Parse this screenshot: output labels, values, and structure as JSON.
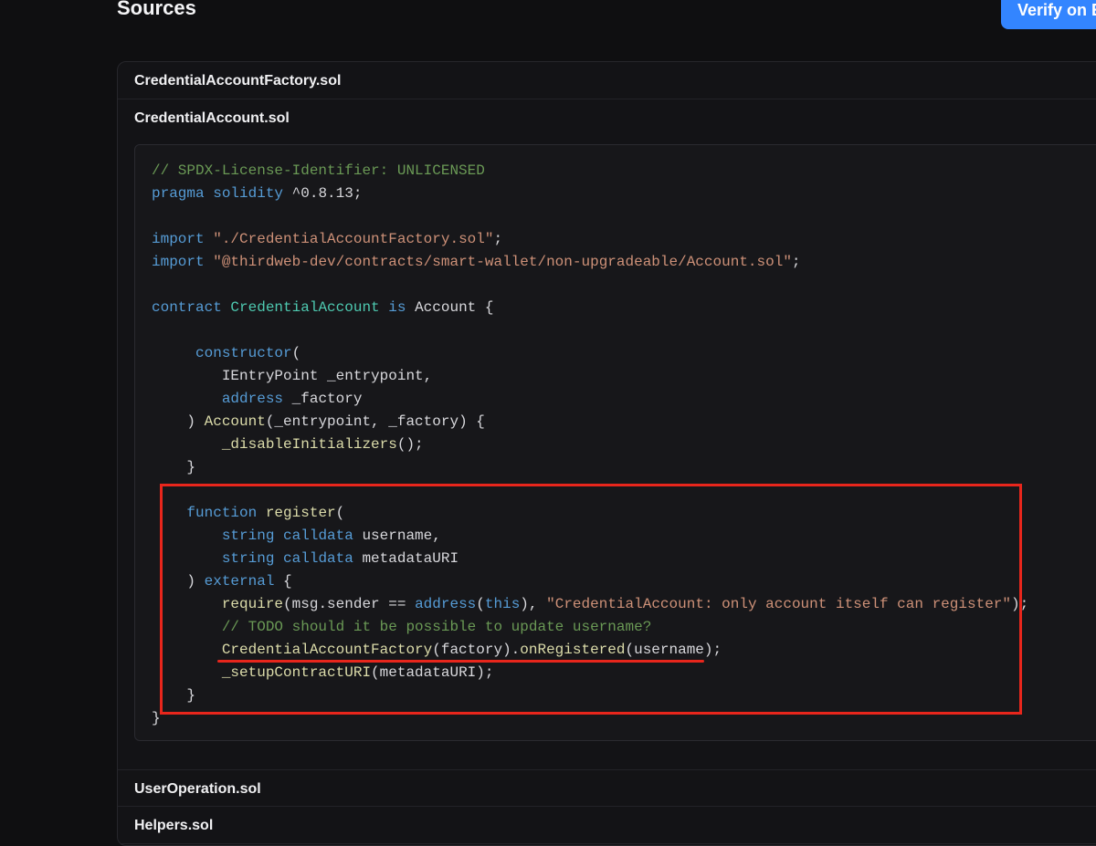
{
  "header": {
    "title": "Sources",
    "verify_button": "Verify on Etherscan"
  },
  "files": [
    {
      "name": "CredentialAccountFactory.sol"
    },
    {
      "name": "CredentialAccount.sol"
    },
    {
      "name": "UserOperation.sol"
    },
    {
      "name": "Helpers.sol"
    }
  ],
  "code_lines": [
    [
      {
        "t": "// SPDX-License-Identifier: UNLICENSED",
        "c": "com"
      }
    ],
    [
      {
        "t": "pragma",
        "c": "kw"
      },
      {
        "t": " ",
        "c": "plain"
      },
      {
        "t": "solidity",
        "c": "kw"
      },
      {
        "t": " ^0.8.13;",
        "c": "plain"
      }
    ],
    [],
    [
      {
        "t": "import",
        "c": "kw"
      },
      {
        "t": " ",
        "c": "plain"
      },
      {
        "t": "\"./CredentialAccountFactory.sol\"",
        "c": "str"
      },
      {
        "t": ";",
        "c": "plain"
      }
    ],
    [
      {
        "t": "import",
        "c": "kw"
      },
      {
        "t": " ",
        "c": "plain"
      },
      {
        "t": "\"@thirdweb-dev/contracts/smart-wallet/non-upgradeable/Account.sol\"",
        "c": "str"
      },
      {
        "t": ";",
        "c": "plain"
      }
    ],
    [],
    [
      {
        "t": "contract",
        "c": "kw"
      },
      {
        "t": " ",
        "c": "plain"
      },
      {
        "t": "CredentialAccount",
        "c": "type"
      },
      {
        "t": " ",
        "c": "plain"
      },
      {
        "t": "is",
        "c": "kw"
      },
      {
        "t": " Account {",
        "c": "plain"
      }
    ],
    [],
    [
      {
        "t": "     ",
        "c": "plain"
      },
      {
        "t": "constructor",
        "c": "kw"
      },
      {
        "t": "(",
        "c": "plain"
      }
    ],
    [
      {
        "t": "        IEntryPoint _entrypoint,",
        "c": "plain"
      }
    ],
    [
      {
        "t": "        ",
        "c": "plain"
      },
      {
        "t": "address",
        "c": "kw"
      },
      {
        "t": " _factory",
        "c": "plain"
      }
    ],
    [
      {
        "t": "    ) ",
        "c": "plain"
      },
      {
        "t": "Account",
        "c": "fn"
      },
      {
        "t": "(_entrypoint, _factory) {",
        "c": "plain"
      }
    ],
    [
      {
        "t": "        ",
        "c": "plain"
      },
      {
        "t": "_disableInitializers",
        "c": "fn"
      },
      {
        "t": "();",
        "c": "plain"
      }
    ],
    [
      {
        "t": "    }",
        "c": "plain"
      }
    ],
    [],
    [
      {
        "t": "    ",
        "c": "plain"
      },
      {
        "t": "function",
        "c": "kw"
      },
      {
        "t": " ",
        "c": "plain"
      },
      {
        "t": "register",
        "c": "fn"
      },
      {
        "t": "(",
        "c": "plain"
      }
    ],
    [
      {
        "t": "        ",
        "c": "plain"
      },
      {
        "t": "string",
        "c": "kw"
      },
      {
        "t": " ",
        "c": "plain"
      },
      {
        "t": "calldata",
        "c": "kw"
      },
      {
        "t": " username,",
        "c": "plain"
      }
    ],
    [
      {
        "t": "        ",
        "c": "plain"
      },
      {
        "t": "string",
        "c": "kw"
      },
      {
        "t": " ",
        "c": "plain"
      },
      {
        "t": "calldata",
        "c": "kw"
      },
      {
        "t": " metadataURI",
        "c": "plain"
      }
    ],
    [
      {
        "t": "    ) ",
        "c": "plain"
      },
      {
        "t": "external",
        "c": "kw"
      },
      {
        "t": " {",
        "c": "plain"
      }
    ],
    [
      {
        "t": "        ",
        "c": "plain"
      },
      {
        "t": "require",
        "c": "fn"
      },
      {
        "t": "(msg.sender == ",
        "c": "plain"
      },
      {
        "t": "address",
        "c": "kw"
      },
      {
        "t": "(",
        "c": "plain"
      },
      {
        "t": "this",
        "c": "kw"
      },
      {
        "t": "), ",
        "c": "plain"
      },
      {
        "t": "\"CredentialAccount: only account itself can register\"",
        "c": "str"
      },
      {
        "t": ");",
        "c": "plain"
      }
    ],
    [
      {
        "t": "        ",
        "c": "plain"
      },
      {
        "t": "// TODO should it be possible to update username?",
        "c": "com"
      }
    ],
    [
      {
        "t": "        ",
        "c": "plain"
      },
      {
        "t": "CredentialAccountFactory",
        "c": "fn"
      },
      {
        "t": "(factory).",
        "c": "plain"
      },
      {
        "t": "onRegistered",
        "c": "fn"
      },
      {
        "t": "(username);",
        "c": "plain"
      }
    ],
    [
      {
        "t": "        ",
        "c": "plain"
      },
      {
        "t": "_setupContractURI",
        "c": "fn"
      },
      {
        "t": "(metadataURI);",
        "c": "plain"
      }
    ],
    [
      {
        "t": "    }",
        "c": "plain"
      }
    ],
    [
      {
        "t": "}",
        "c": "plain"
      }
    ]
  ],
  "colors": {
    "background": "#0f0f11",
    "panel": "#131316",
    "code_background": "#17171a",
    "accent_button": "#3385ff",
    "annotation_red": "#e8261c",
    "comment": "#6a9955",
    "keyword": "#569cd6",
    "string": "#ce9178",
    "function": "#dcdcaa",
    "type": "#4ec9b0"
  }
}
